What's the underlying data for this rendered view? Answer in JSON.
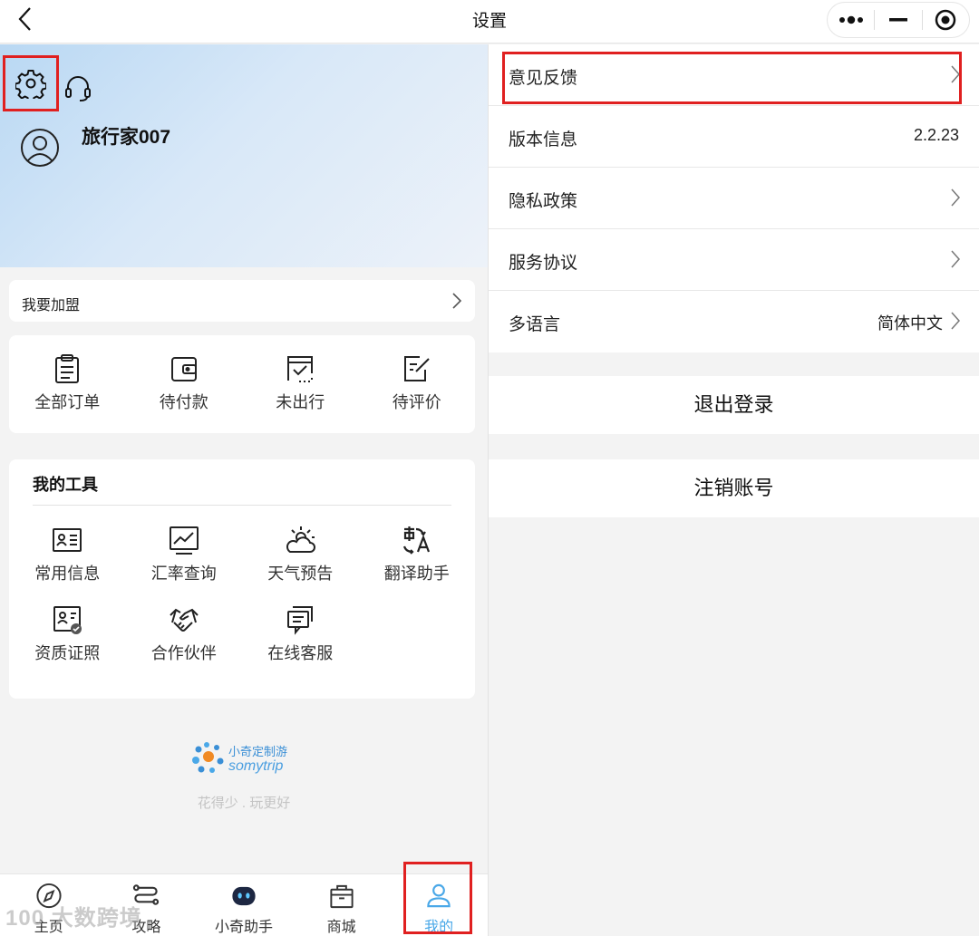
{
  "top_bar": {
    "title": "设置"
  },
  "profile": {
    "username": "旅行家007"
  },
  "join": {
    "label": "我要加盟"
  },
  "orders": [
    {
      "label": "全部订单",
      "icon": "clipboard-icon"
    },
    {
      "label": "待付款",
      "icon": "wallet-icon"
    },
    {
      "label": "未出行",
      "icon": "calendar-check-icon"
    },
    {
      "label": "待评价",
      "icon": "edit-note-icon"
    }
  ],
  "tools": {
    "title": "我的工具",
    "row1": [
      {
        "label": "常用信息",
        "icon": "id-card-icon"
      },
      {
        "label": "汇率查询",
        "icon": "exchange-chart-icon"
      },
      {
        "label": "天气预告",
        "icon": "weather-icon"
      },
      {
        "label": "翻译助手",
        "icon": "translate-icon"
      }
    ],
    "row2": [
      {
        "label": "资质证照",
        "icon": "certificate-icon"
      },
      {
        "label": "合作伙伴",
        "icon": "handshake-icon"
      },
      {
        "label": "在线客服",
        "icon": "chat-icon"
      }
    ]
  },
  "brand": {
    "name_cn": "小奇定制游",
    "name_en": "somytrip",
    "slogan": "花得少 . 玩更好"
  },
  "tabbar": [
    {
      "label": "主页",
      "icon": "compass-icon"
    },
    {
      "label": "攻略",
      "icon": "route-icon"
    },
    {
      "label": "小奇助手",
      "icon": "robot-icon"
    },
    {
      "label": "商城",
      "icon": "shop-bag-icon"
    },
    {
      "label": "我的",
      "icon": "user-icon",
      "active": true
    }
  ],
  "watermark": "100 大数跨境",
  "settings": {
    "rows": [
      {
        "label": "意见反馈"
      },
      {
        "label": "版本信息",
        "value": "2.2.23"
      },
      {
        "label": "隐私政策"
      },
      {
        "label": "服务协议"
      },
      {
        "label": "多语言",
        "value": "简体中文"
      }
    ],
    "logout": "退出登录",
    "delete_account": "注销账号"
  },
  "colors": {
    "highlight": "#e02020",
    "active_tab": "#4aa8e8",
    "header_gradient_start": "#b9d8f3"
  }
}
